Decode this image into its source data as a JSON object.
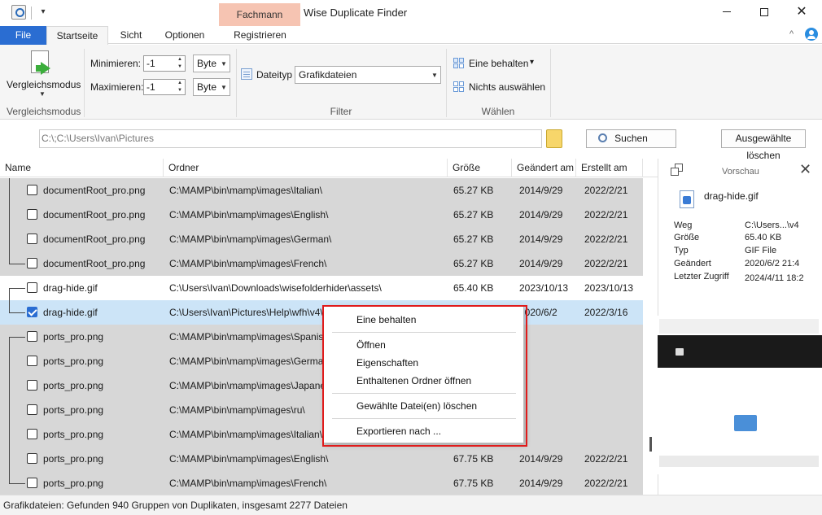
{
  "titlebar": {
    "app_title": "Wise Duplicate Finder",
    "context_tab": "Fachmann",
    "qa_dropdown_glyph": "▾",
    "minimize_icon": "minimize-icon",
    "maximize_icon": "maximize-icon",
    "close_glyph": "✕"
  },
  "tabs": [
    {
      "label": "File"
    },
    {
      "label": "Startseite"
    },
    {
      "label": "Sicht"
    },
    {
      "label": "Optionen"
    },
    {
      "label": "Registrieren"
    }
  ],
  "ribbon": {
    "compare_mode": {
      "label": "Vergleichsmodus",
      "group": "Vergleichsmodus",
      "dropdown_glyph": "▼"
    },
    "filter": {
      "group": "Filter",
      "min_label": "Minimieren:",
      "min_value": "-1",
      "min_unit": "Byte",
      "max_label": "Maximieren:",
      "max_value": "-1",
      "max_unit": "Byte",
      "filetype_label": "Dateityp",
      "filetype_value": "Grafikdateien",
      "spin_up_glyph": "▲",
      "spin_down_glyph": "▼",
      "combo_glyph": "▼"
    },
    "select": {
      "group": "Wählen",
      "keep_one": "Eine behalten",
      "keep_one_glyph": "▾",
      "select_none": "Nichts auswählen"
    }
  },
  "pathbar": {
    "path": "C:\\;C:\\Users\\Ivan\\Pictures",
    "search_label": "Suchen",
    "delete_label": "Ausgewählte löschen"
  },
  "table": {
    "columns": [
      "Name",
      "Ordner",
      "Größe",
      "Geändert am",
      "Erstellt am"
    ],
    "rows": [
      {
        "name": "documentRoot_pro.png",
        "folder": "C:\\MAMP\\bin\\mamp\\images\\Italian\\",
        "size": "65.27 KB",
        "modified": "2014/9/29",
        "created": "2022/2/21",
        "checked": false
      },
      {
        "name": "documentRoot_pro.png",
        "folder": "C:\\MAMP\\bin\\mamp\\images\\English\\",
        "size": "65.27 KB",
        "modified": "2014/9/29",
        "created": "2022/2/21",
        "checked": false
      },
      {
        "name": "documentRoot_pro.png",
        "folder": "C:\\MAMP\\bin\\mamp\\images\\German\\",
        "size": "65.27 KB",
        "modified": "2014/9/29",
        "created": "2022/2/21",
        "checked": false
      },
      {
        "name": "documentRoot_pro.png",
        "folder": "C:\\MAMP\\bin\\mamp\\images\\French\\",
        "size": "65.27 KB",
        "modified": "2014/9/29",
        "created": "2022/2/21",
        "checked": false
      },
      {
        "name": "drag-hide.gif",
        "folder": "C:\\Users\\Ivan\\Downloads\\wisefolderhider\\assets\\",
        "size": "65.40 KB",
        "modified": "2023/10/13",
        "created": "2023/10/13",
        "checked": false
      },
      {
        "name": "drag-hide.gif",
        "folder": "C:\\Users\\Ivan\\Pictures\\Help\\wfh\\v4\\",
        "size": "",
        "modified": "2020/6/2",
        "created": "2022/3/16",
        "checked": true
      },
      {
        "name": "ports_pro.png",
        "folder": "C:\\MAMP\\bin\\mamp\\images\\Spanish\\",
        "size": "",
        "modified": "",
        "created": "",
        "checked": false
      },
      {
        "name": "ports_pro.png",
        "folder": "C:\\MAMP\\bin\\mamp\\images\\German\\",
        "size": "",
        "modified": "",
        "created": "",
        "checked": false
      },
      {
        "name": "ports_pro.png",
        "folder": "C:\\MAMP\\bin\\mamp\\images\\Japanese\\",
        "size": "",
        "modified": "",
        "created": "",
        "checked": false
      },
      {
        "name": "ports_pro.png",
        "folder": "C:\\MAMP\\bin\\mamp\\images\\ru\\",
        "size": "",
        "modified": "",
        "created": "",
        "checked": false
      },
      {
        "name": "ports_pro.png",
        "folder": "C:\\MAMP\\bin\\mamp\\images\\Italian\\",
        "size": "",
        "modified": "",
        "created": "",
        "checked": false
      },
      {
        "name": "ports_pro.png",
        "folder": "C:\\MAMP\\bin\\mamp\\images\\English\\",
        "size": "67.75 KB",
        "modified": "2014/9/29",
        "created": "2022/2/21",
        "checked": false
      },
      {
        "name": "ports_pro.png",
        "folder": "C:\\MAMP\\bin\\mamp\\images\\French\\",
        "size": "67.75 KB",
        "modified": "2014/9/29",
        "created": "2022/2/21",
        "checked": false
      }
    ]
  },
  "preview": {
    "title": "Vorschau",
    "close_glyph": "✕",
    "file_name": "drag-hide.gif",
    "props": [
      {
        "key": "Weg",
        "value": "C:\\Users...\\v4"
      },
      {
        "key": "Größe",
        "value": "65.40 KB"
      },
      {
        "key": "Typ",
        "value": "GIF File"
      },
      {
        "key": "Geändert",
        "value": "2020/6/2 21:4"
      },
      {
        "key": "Letzter Zugriff",
        "value": "2024/4/11 18:2"
      }
    ]
  },
  "context_menu": {
    "items": [
      "Eine behalten",
      "Öffnen",
      "Eigenschaften",
      "Enthaltenen Ordner öffnen",
      "Gewählte Datei(en) löschen",
      "Exportieren nach ..."
    ]
  },
  "status": {
    "text": "Grafikdateien: Gefunden 940 Gruppen von Duplikaten, insgesamt 2277 Dateien"
  },
  "colors": {
    "accent": "#2a6dd2",
    "context_tab": "#f6c4b2",
    "row_gray": "#d7d7d7",
    "row_selected": "#cce4f7",
    "highlight_border": "#e01b1b"
  }
}
